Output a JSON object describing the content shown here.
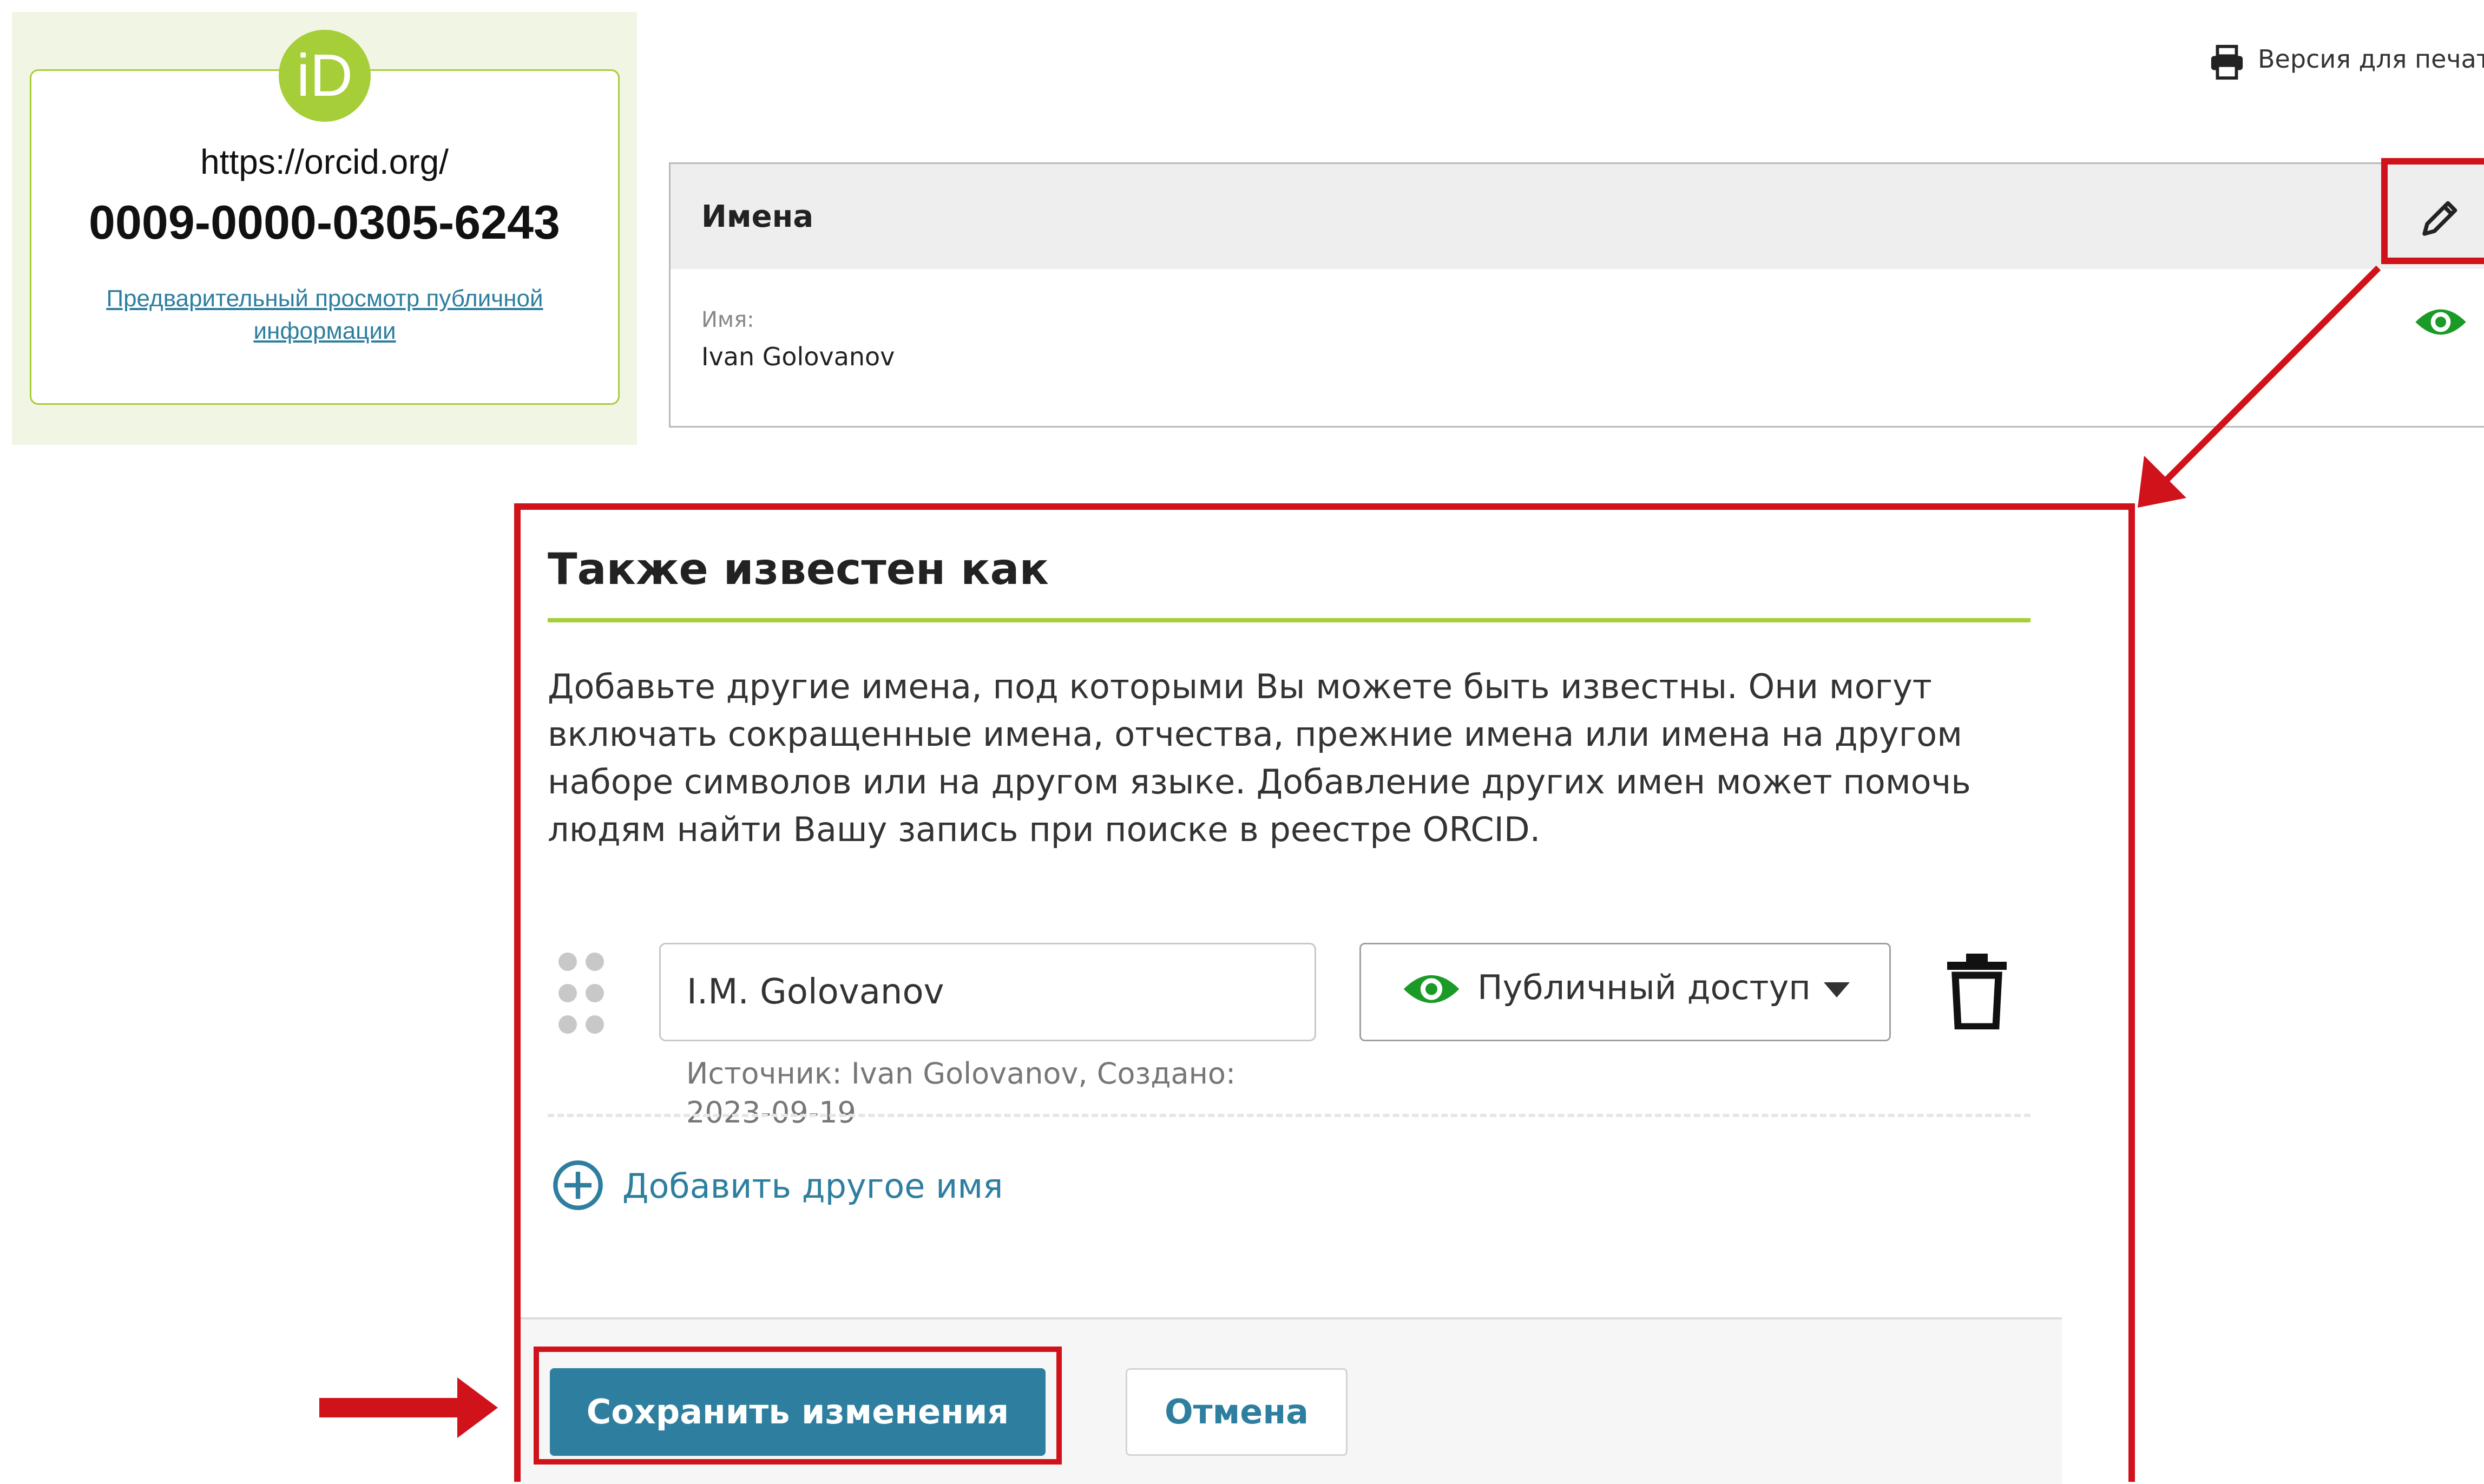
{
  "orcid": {
    "logo_text": "iD",
    "url": "https://orcid.org/",
    "id": "0009-0000-0305-6243",
    "preview_link": "Предварительный просмотр публичной информации"
  },
  "print": {
    "label": "Версия для печати",
    "icon": "printer-icon"
  },
  "names": {
    "title": "Имена",
    "field_label": "Имя:",
    "field_value": "Ivan Golovanov",
    "edit_icon": "pencil-icon",
    "visibility_icon": "eye-icon"
  },
  "aka": {
    "title": "Также известен как",
    "description": "Добавьте другие имена, под которыми Вы можете быть известны. Они могут включать сокращенные имена, отчества, прежние имена или имена на другом наборе символов или на другом языке. Добавление других имен может помочь людям найти Вашу запись при поиске в реестре ORCID.",
    "entry": {
      "value": "I.M. Golovanov",
      "visibility": "Публичный доступ",
      "source": "Источник: Ivan Golovanov, Создано: 2023-09-19"
    },
    "add_label": "Добавить другое имя",
    "save_label": "Сохранить изменения",
    "cancel_label": "Отмена"
  },
  "colors": {
    "orcid_green": "#a6ce39",
    "accent_blue": "#2e7f9f",
    "annotation_red": "#d0121b",
    "eye_green": "#1a9a27"
  }
}
